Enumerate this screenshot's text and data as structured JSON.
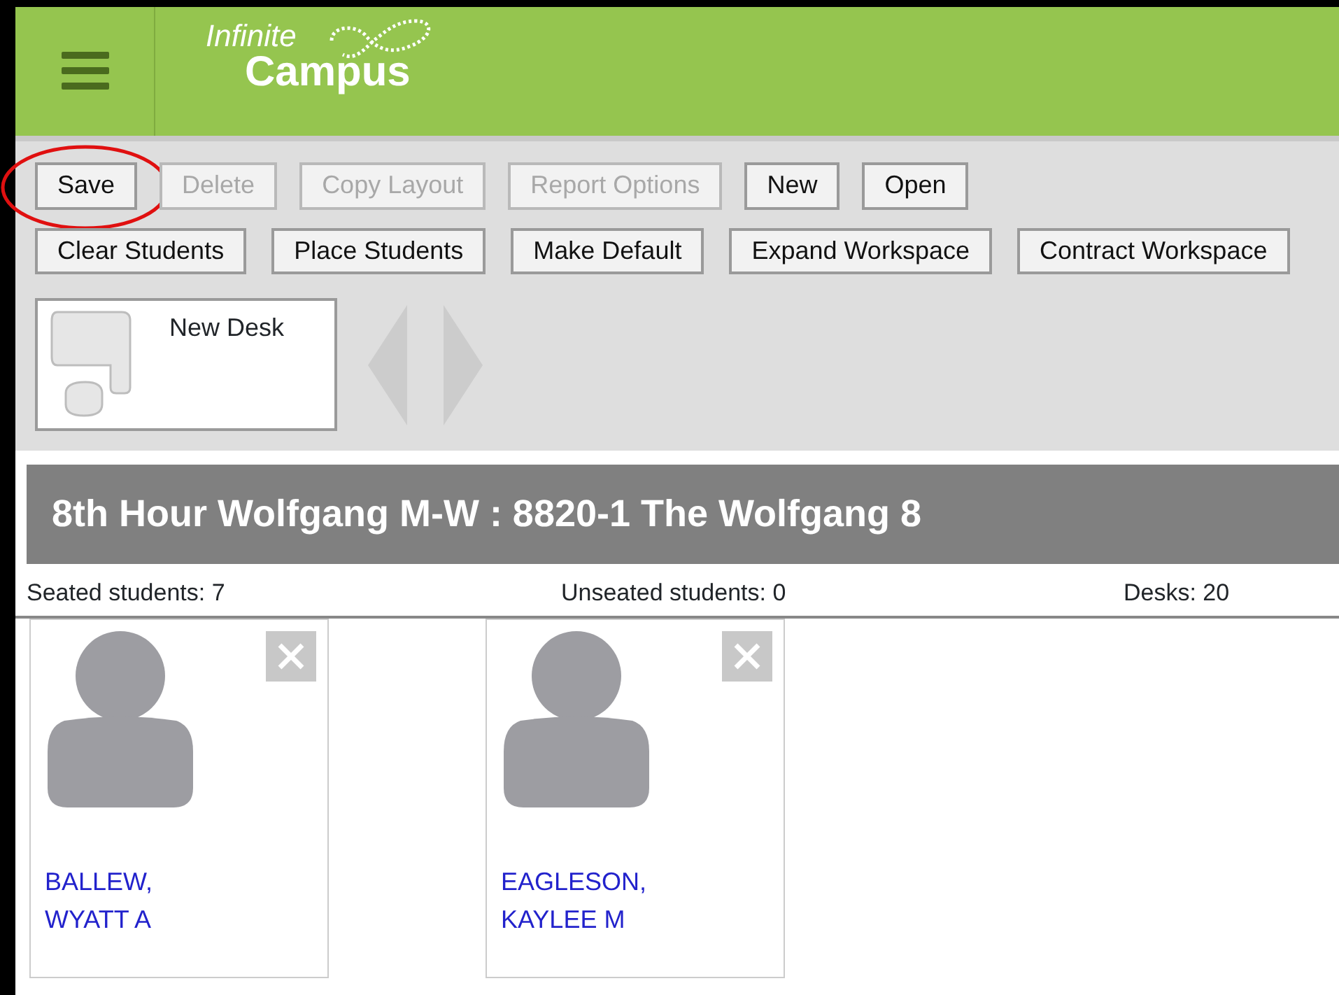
{
  "header": {
    "logo_top": "Infinite",
    "logo_bottom": "Campus"
  },
  "toolbar_rows": [
    [
      {
        "label": "Save",
        "disabled": false,
        "highlighted": true
      },
      {
        "label": "Delete",
        "disabled": true,
        "highlighted": false
      },
      {
        "label": "Copy Layout",
        "disabled": true,
        "highlighted": false
      },
      {
        "label": "Report Options",
        "disabled": true,
        "highlighted": false
      },
      {
        "label": "New",
        "disabled": false,
        "highlighted": false
      },
      {
        "label": "Open",
        "disabled": false,
        "highlighted": false
      }
    ],
    [
      {
        "label": "Clear Students",
        "disabled": false,
        "highlighted": false
      },
      {
        "label": "Place Students",
        "disabled": false,
        "highlighted": false
      },
      {
        "label": "Make Default",
        "disabled": false,
        "highlighted": false
      },
      {
        "label": "Expand Workspace",
        "disabled": false,
        "highlighted": false
      },
      {
        "label": "Contract Workspace",
        "disabled": false,
        "highlighted": false
      }
    ]
  ],
  "palette": {
    "items": [
      {
        "label": "New Desk"
      }
    ],
    "prev_disabled": true,
    "next_disabled": true
  },
  "section_title": "8th Hour Wolfgang M-W : 8820-1 The Wolfgang 8",
  "stats": [
    "Seated students: 7",
    "Unseated students: 0",
    "Desks: 20"
  ],
  "students": [
    {
      "name_lines": [
        "BALLEW,",
        "WYATT A"
      ]
    },
    {
      "name_lines": [
        "EAGLESON,",
        "KAYLEE M"
      ]
    }
  ]
}
